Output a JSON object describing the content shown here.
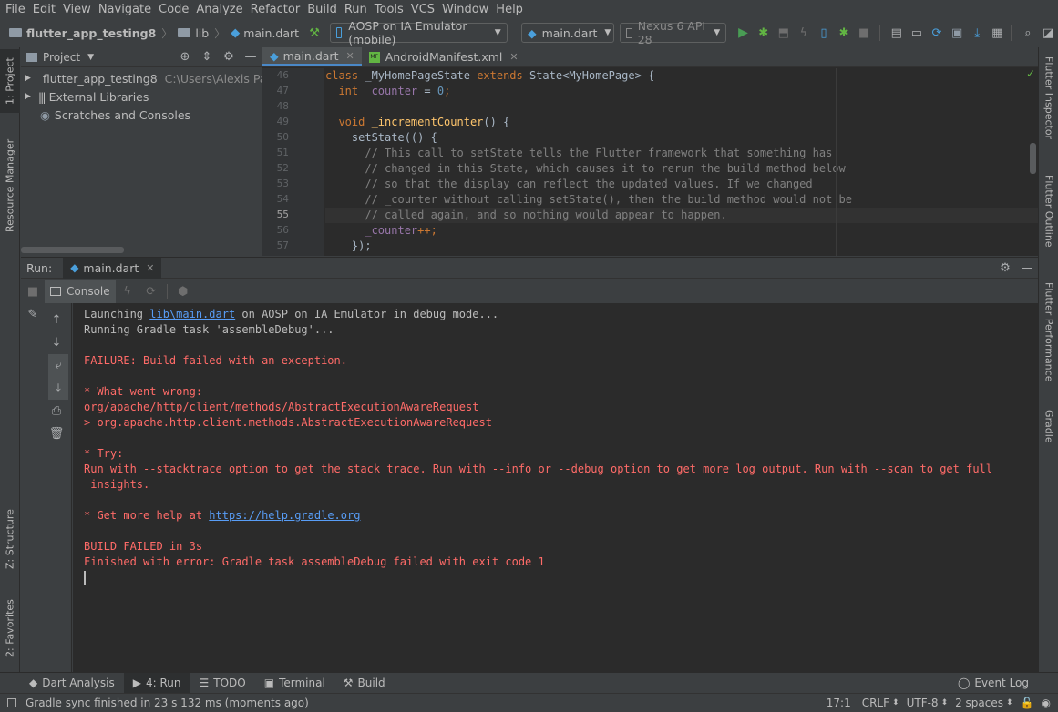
{
  "menu": [
    "File",
    "Edit",
    "View",
    "Navigate",
    "Code",
    "Analyze",
    "Refactor",
    "Build",
    "Run",
    "Tools",
    "VCS",
    "Window",
    "Help"
  ],
  "nav": {
    "project": "flutter_app_testing8",
    "folder": "lib",
    "file": "main.dart",
    "device": "AOSP on IA Emulator (mobile)",
    "run_config": "main.dart",
    "avd": "Nexus 6 API 28"
  },
  "left_tabs": {
    "project": "1: Project",
    "resource": "Resource Manager",
    "structure": "Z: Structure",
    "favorites": "2: Favorites"
  },
  "right_tabs": {
    "inspector": "Flutter Inspector",
    "outline": "Flutter Outline",
    "performance": "Flutter Performance",
    "gradle": "Gradle"
  },
  "project_panel": {
    "title": "Project",
    "items": [
      {
        "label": "flutter_app_testing8",
        "path": "C:\\Users\\Alexis Parker"
      },
      {
        "label": "External Libraries",
        "path": ""
      },
      {
        "label": "Scratches and Consoles",
        "path": ""
      }
    ]
  },
  "editor": {
    "tabs": [
      "main.dart",
      "AndroidManifest.xml"
    ],
    "line_numbers": [
      "46",
      "47",
      "48",
      "49",
      "50",
      "51",
      "52",
      "53",
      "54",
      "55",
      "56",
      "57"
    ],
    "lines": {
      "l46a": "class ",
      "l46b": "_MyHomePageState ",
      "l46c": "extends ",
      "l46d": "State<MyHomePage> {",
      "l47a": "  int ",
      "l47b": "_counter",
      "l47c": " = ",
      "l47d": "0",
      "l47e": ";",
      "l49a": "  void ",
      "l49b": "_incrementCounter",
      "l49c": "() {",
      "l50": "    setState(() {",
      "l51": "      // This call to setState tells the Flutter framework that something has",
      "l52": "      // changed in this State, which causes it to rerun the build method below",
      "l53": "      // so that the display can reflect the updated values. If we changed",
      "l54": "      // _counter without calling setState(), then the build method would not be",
      "l55": "      // called again, and so nothing would appear to happen.",
      "l56a": "      ",
      "l56b": "_counter",
      "l56c": "++;",
      "l57": "    });"
    }
  },
  "run": {
    "label": "Run:",
    "tab": "main.dart",
    "console_tab": "Console"
  },
  "console": {
    "l1a": "Launching ",
    "l1b": "lib\\main.dart",
    "l1c": " on AOSP on IA Emulator in debug mode...",
    "l2": "Running Gradle task 'assembleDebug'...",
    "l3": "FAILURE: Build failed with an exception.",
    "l4": "* What went wrong:",
    "l5": "org/apache/http/client/methods/AbstractExecutionAwareRequest",
    "l6": "> org.apache.http.client.methods.AbstractExecutionAwareRequest",
    "l7": "* Try:",
    "l8": "Run with --stacktrace option to get the stack trace. Run with --info or --debug option to get more log output. Run with --scan to get full",
    "l9": " insights.",
    "l10a": "* Get more help at ",
    "l10b": "https://help.gradle.org",
    "l11": "BUILD FAILED in 3s",
    "l12": "Finished with error: Gradle task assembleDebug failed with exit code 1"
  },
  "bottom_tabs": {
    "dart": "Dart Analysis",
    "run": "4: Run",
    "todo": "TODO",
    "terminal": "Terminal",
    "build": "Build",
    "event": "Event Log"
  },
  "status": {
    "message": "Gradle sync finished in 23 s 132 ms (moments ago)",
    "position": "17:1",
    "line_sep": "CRLF",
    "encoding": "UTF-8",
    "indent": "2 spaces"
  },
  "colors": {
    "accent": "#4a88c7",
    "error": "#ff6b68",
    "keyword": "#cc7832",
    "comment": "#808080",
    "field": "#9876aa",
    "link": "#589df6"
  }
}
